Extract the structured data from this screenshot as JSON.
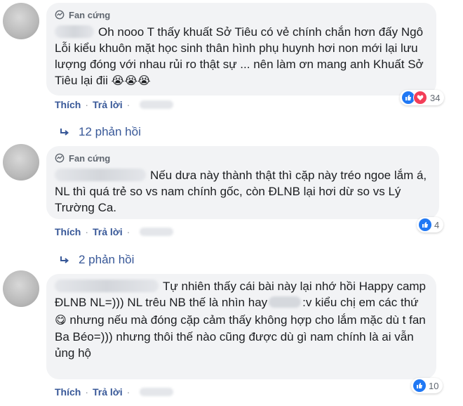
{
  "badge_label": "Fan cứng",
  "actions": {
    "like": "Thích",
    "reply": "Trả lời",
    "separator": "·"
  },
  "comments": [
    {
      "text": "Oh nooo T thấy khuất Sở Tiêu có vẻ chính chắn hơn đấy Ngô Lỗi kiểu khuôn mặt học sinh thân hình phụ huynh hơi non mới lại lưu lượng đóng với nhau rủi ro thật sự ... nên làm ơn mang anh Khuất Sở Tiêu lại đii",
      "emoji": "😭😭😭",
      "reaction_count": "34",
      "replies": "12 phản hồi"
    },
    {
      "text": "Nếu dưa này thành thật thì cặp này tréo ngoe lắm á, NL thì quá trẻ so vs nam chính gốc, còn ĐLNB lại hơi dừ so vs Lý Trường Ca.",
      "reaction_count": "4",
      "replies": "2 phản hồi"
    },
    {
      "text_a": "Tự nhiên thấy cái bài này lại nhớ hồi Happy camp ĐLNB NL=))) NL trêu NB thế là nhìn hay",
      "text_b": ":v kiểu chị em các thứ",
      "text_c": "nhưng nếu mà đóng cặp cảm thấy không hợp cho lắm mặc dù t fan Ba Béo=))) nhưng thôi thế nào cũng được dù gì nam chính là ai vẫn ủng hộ",
      "emoji": "😋",
      "reaction_count": "10"
    }
  ],
  "colors": {
    "link": "#385898",
    "bubble": "#f2f3f5",
    "like": "#2078f4",
    "love": "#f33e58"
  }
}
